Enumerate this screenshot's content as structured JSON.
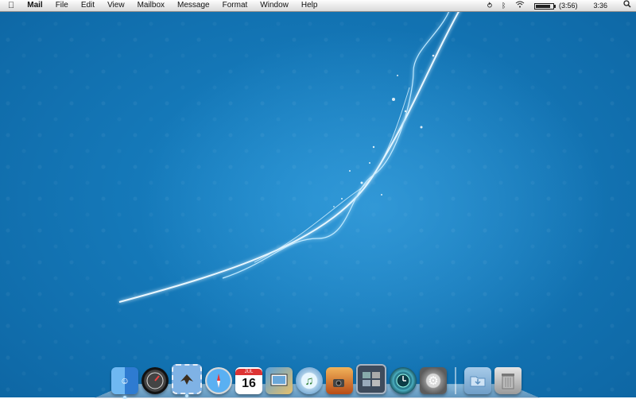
{
  "menubar": {
    "apple_icon": "apple-icon",
    "app_name": "Mail",
    "menus": [
      "File",
      "Edit",
      "View",
      "Mailbox",
      "Message",
      "Format",
      "Window",
      "Help"
    ],
    "status": {
      "battery_time": "(3:56)",
      "battery_level": 0.6,
      "clock": "3:36",
      "icons": [
        "time-machine-status-icon",
        "bluetooth-icon",
        "wifi-icon",
        "battery-icon",
        "spotlight-icon"
      ]
    }
  },
  "dock": {
    "apps": [
      {
        "name": "finder",
        "label": "",
        "running": true
      },
      {
        "name": "dashboard",
        "label": "",
        "running": false
      },
      {
        "name": "mail",
        "label": "",
        "running": true
      },
      {
        "name": "safari",
        "label": "",
        "running": false
      },
      {
        "name": "ical",
        "label": "16",
        "month": "JUL",
        "running": false
      },
      {
        "name": "iphoto",
        "label": "",
        "running": false
      },
      {
        "name": "itunes",
        "label": "♫",
        "running": false
      },
      {
        "name": "imovie",
        "label": "",
        "running": false
      },
      {
        "name": "spaces",
        "label": "",
        "running": false
      },
      {
        "name": "time-machine",
        "label": "",
        "running": false
      },
      {
        "name": "system-preferences",
        "label": "⚙",
        "running": false
      }
    ],
    "stacks": [
      {
        "name": "downloads",
        "running": false
      },
      {
        "name": "trash",
        "running": false
      }
    ]
  }
}
